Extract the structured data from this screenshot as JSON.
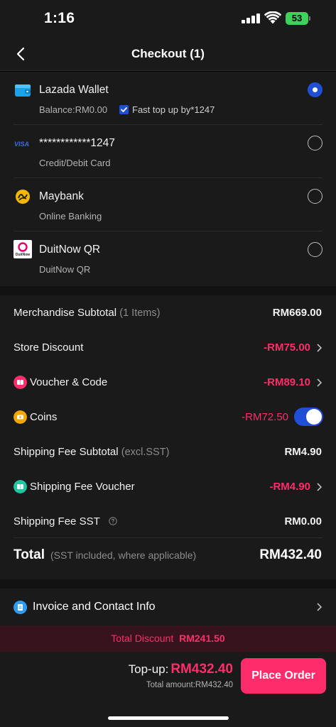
{
  "status_bar": {
    "time": "1:16",
    "battery": "53"
  },
  "header": {
    "title": "Checkout (1)"
  },
  "payment_methods": [
    {
      "title": "Lazada Wallet",
      "subtitle": "Balance:RM0.00",
      "selected": true,
      "icon": "wallet-icon",
      "extra": "Fast top up by*1247"
    },
    {
      "title": "************1247",
      "subtitle": "Credit/Debit Card",
      "selected": false,
      "icon": "visa-icon",
      "icon_text": "VISA"
    },
    {
      "title": "Maybank",
      "subtitle": "Online Banking",
      "selected": false,
      "icon": "maybank-icon"
    },
    {
      "title": "DuitNow QR",
      "subtitle": "DuitNow QR",
      "selected": false,
      "icon": "duitnow-icon",
      "icon_text": "DuitNow"
    }
  ],
  "summary": {
    "merchandise": {
      "label": "Merchandise Subtotal",
      "note": "(1 Items)",
      "value": "RM669.00"
    },
    "store_discount": {
      "label": "Store Discount",
      "value": "-RM75.00"
    },
    "voucher": {
      "label": "Voucher & Code",
      "value": "-RM89.10"
    },
    "coins": {
      "label": "Coins",
      "value": "-RM72.50",
      "enabled": true
    },
    "shipping_subtotal": {
      "label": "Shipping Fee Subtotal",
      "note": "(excl.SST)",
      "value": "RM4.90"
    },
    "shipping_voucher": {
      "label": "Shipping Fee Voucher",
      "value": "-RM4.90"
    },
    "shipping_sst": {
      "label": "Shipping Fee SST",
      "value": "RM0.00"
    },
    "total": {
      "label": "Total",
      "note": "(SST included, where applicable)",
      "value": "RM432.40"
    }
  },
  "invoice": {
    "label": "Invoice and Contact Info"
  },
  "discount_bar": {
    "label": "Total Discount",
    "value": "RM241.50"
  },
  "footer": {
    "topup_label": "Top-up:",
    "topup_amount": "RM432.40",
    "total_amount": "Total amount:RM432.40",
    "place_order": "Place Order"
  },
  "colors": {
    "accent_pink": "#fe2c6a",
    "accent_blue": "#1f4fd6",
    "background": "#1a1a1a"
  }
}
